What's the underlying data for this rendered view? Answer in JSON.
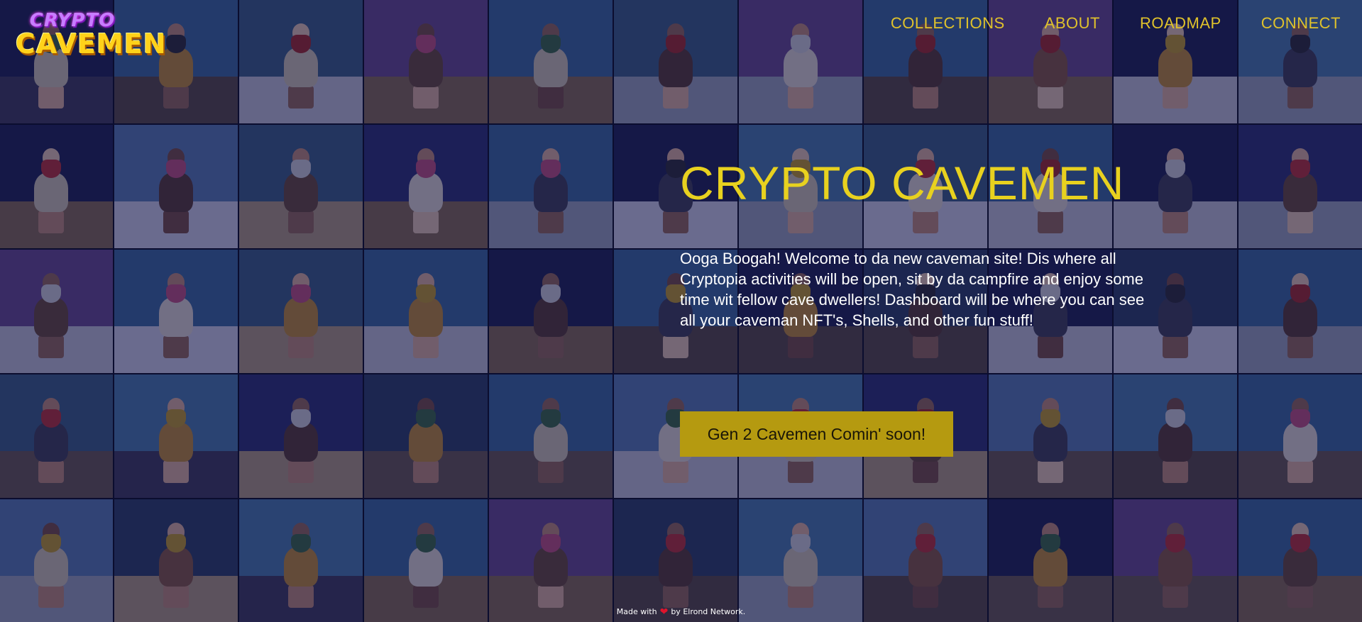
{
  "logo": {
    "line1": "CRYPTO",
    "line2": "CAVEMEN"
  },
  "nav": {
    "items": [
      {
        "label": "COLLECTIONS"
      },
      {
        "label": "ABOUT"
      },
      {
        "label": "ROADMAP"
      },
      {
        "label": "CONNECT"
      }
    ]
  },
  "hero": {
    "title": "CRYPTO CAVEMEN",
    "text": "Ooga Boogah! Welcome to da new caveman site! Dis where all Cryptopia activities will be open, sit by da campfire and enjoy some time wit fellow cave dwellers! Dashboard will be where you can see all your caveman NFT's, Shells, and other fun stuff!",
    "cta_label": "Gen 2 Cavemen Comin' soon!"
  },
  "footer": {
    "made_with": "Made with",
    "heart_icon": "heart-icon",
    "by": "by Elrond Network."
  },
  "colors": {
    "accent": "#e8d11f",
    "button": "#b59a10",
    "overlay": "#101246"
  }
}
